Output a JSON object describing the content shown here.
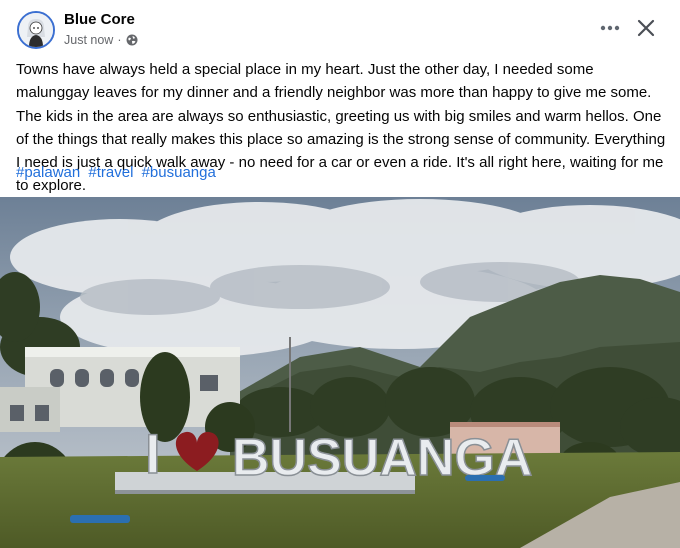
{
  "post": {
    "author": "Blue Core",
    "time": "Just now",
    "separator": "·",
    "privacy_icon": "globe-icon",
    "text": "Towns have always held a special place in my heart. Just the other day, I needed some malunggay leaves for my dinner and a friendly neighbor was more than happy to give me some. The kids in the area are always so enthusiastic, greeting us with big smiles and warm hellos. One of the things that really makes this place so amazing is the strong sense of community. Everything I need is just a quick walk away - no need for a car or even a ride. It's all right here, waiting for me to explore.",
    "hashtags": [
      "#palawan",
      "#travel",
      "#busuanga"
    ],
    "more_icon": "more-options-icon",
    "close_icon": "close-icon"
  },
  "photo": {
    "sign_prefix": "I",
    "sign_word": "BUSUANGA"
  },
  "colors": {
    "link": "#216fdb",
    "secondary_text": "#65676b",
    "avatar_ring": "#3b6fd1"
  }
}
